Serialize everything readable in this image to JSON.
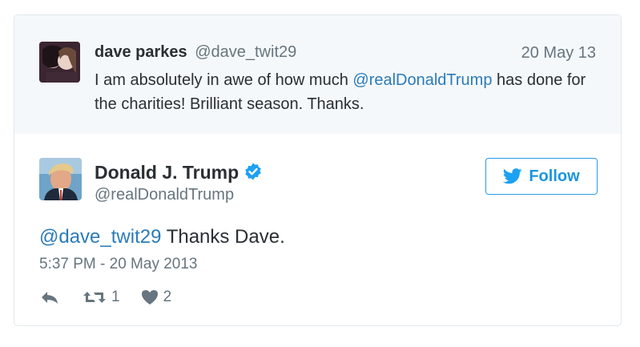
{
  "quoted_tweet": {
    "author_name": "dave parkes",
    "author_handle": "@dave_twit29",
    "date": "20 May 13",
    "text_before": "I am absolutely in awe of how much ",
    "mention": "@realDonaldTrump",
    "text_after": " has done for the charities! Brilliant season. Thanks."
  },
  "main_tweet": {
    "author_name": "Donald J. Trump",
    "author_handle": "@realDonaldTrump",
    "verified_icon": "verified-badge-icon",
    "follow_label": "Follow",
    "reply_mention": "@dave_twit29",
    "reply_text": " Thanks Dave.",
    "timestamp": "5:37 PM - 20 May 2013",
    "retweet_count": "1",
    "like_count": "2"
  },
  "colors": {
    "link": "#2b7bb9",
    "follow_border": "#2b9ae8",
    "muted": "#66757f",
    "quoted_bg": "#f5f8fa"
  }
}
